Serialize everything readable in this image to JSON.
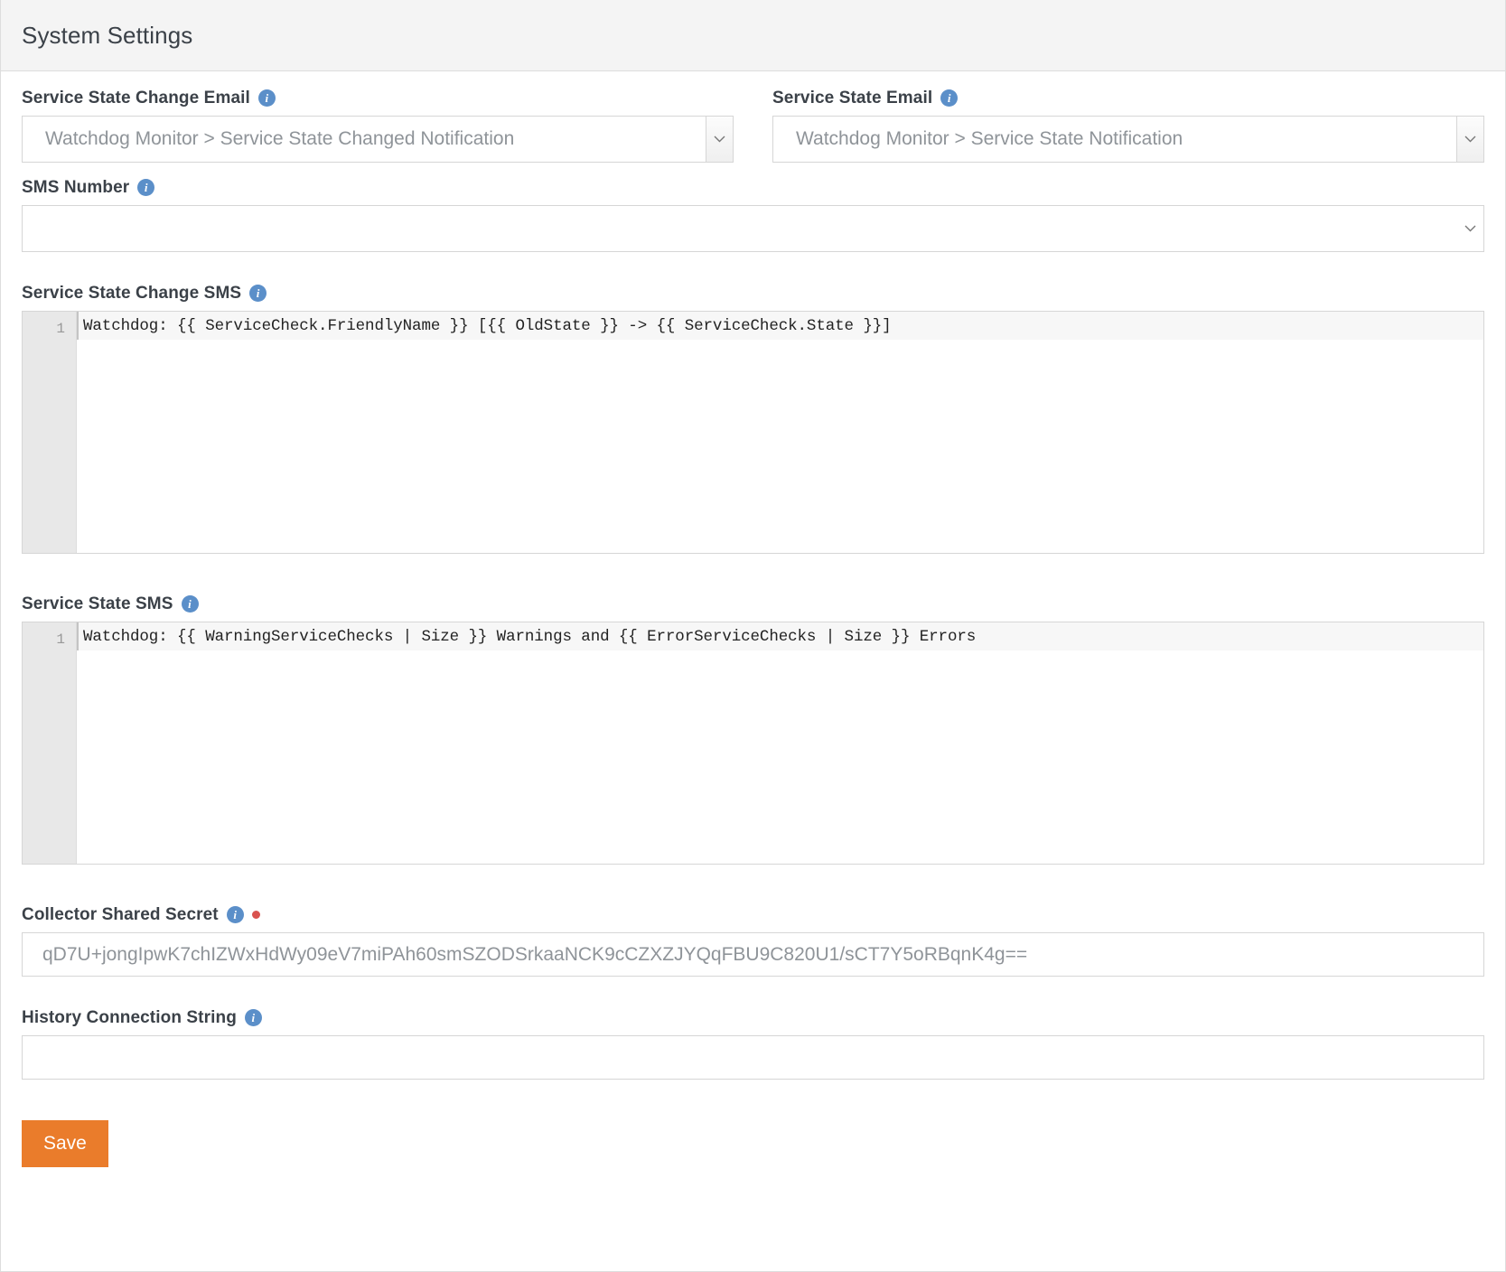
{
  "header": {
    "title": "System Settings"
  },
  "icons": {
    "info": "i",
    "info_name": "info-icon",
    "chevron": "chevron-down-icon"
  },
  "colors": {
    "accent_orange": "#ea7c2b",
    "info_blue": "#5b8fc9",
    "required_red": "#d9534f",
    "header_bg": "#f4f4f4",
    "border": "#d6d6d6",
    "gutter_bg": "#e8e8e8"
  },
  "fields": {
    "service_state_change_email": {
      "label": "Service State Change Email",
      "value": "Watchdog Monitor > Service State Changed Notification",
      "type": "select",
      "required": false
    },
    "service_state_email": {
      "label": "Service State Email",
      "value": "Watchdog Monitor > Service State Notification",
      "type": "select",
      "required": false
    },
    "sms_number": {
      "label": "SMS Number",
      "value": "",
      "placeholder": "",
      "type": "select",
      "required": false
    },
    "service_state_change_sms": {
      "label": "Service State Change SMS",
      "type": "code",
      "line_number": "1",
      "code": "Watchdog: {{ ServiceCheck.FriendlyName }} [{{ OldState }} -> {{ ServiceCheck.State }}]",
      "required": false
    },
    "service_state_sms": {
      "label": "Service State SMS",
      "type": "code",
      "line_number": "1",
      "code": "Watchdog: {{ WarningServiceChecks | Size }} Warnings and {{ ErrorServiceChecks | Size }} Errors",
      "required": false
    },
    "collector_shared_secret": {
      "label": "Collector Shared Secret",
      "value": "qD7U+jongIpwK7chIZWxHdWy09eV7miPAh60smSZODSrkaaNCK9cCZXZJYQqFBU9C820U1/sCT7Y5oRBqnK4g==",
      "type": "text",
      "required": true
    },
    "history_connection_string": {
      "label": "History Connection String",
      "value": "",
      "placeholder": "",
      "type": "text",
      "required": false
    }
  },
  "actions": {
    "save_label": "Save"
  }
}
